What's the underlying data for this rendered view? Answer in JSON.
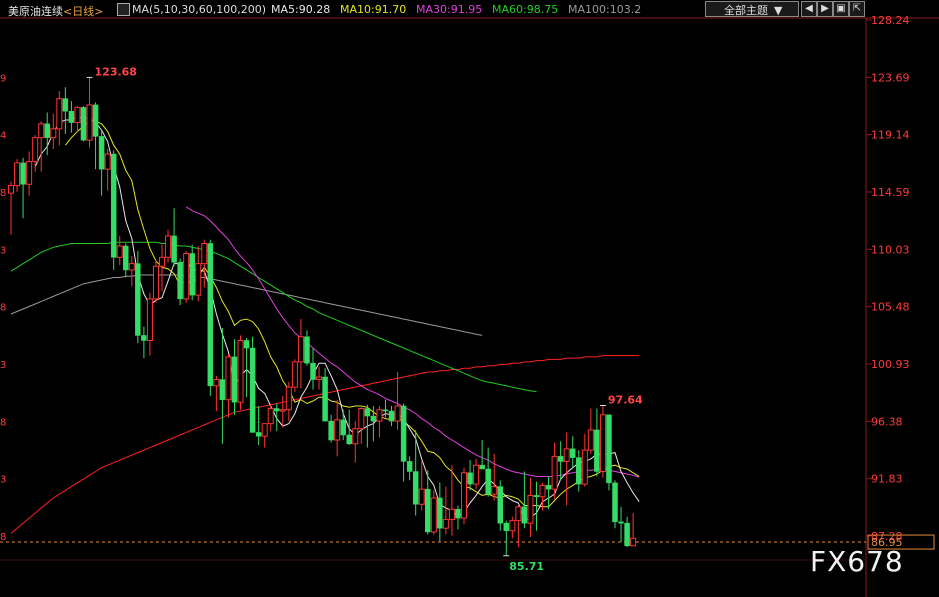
{
  "header": {
    "title": "美原油连续",
    "period": "<日线>",
    "ma_label": "MA(5,10,30,60,100,200)",
    "ma5": "MA5:90.28",
    "ma10": "MA10:91.70",
    "ma30": "MA30:91.95",
    "ma60": "MA60:98.75",
    "ma100": "MA100:103.2",
    "selector": "全部主题",
    "selector_arrow": "▼"
  },
  "watermark": "FX678",
  "colors": {
    "up": "#ff3333",
    "down": "#33dd66",
    "ma5": "#e8e8e8",
    "ma10": "#e6e61e",
    "ma30": "#e040e0",
    "ma60": "#22cc22",
    "ma100": "#9a9a9a",
    "ma200": "#ff2020",
    "axis_text": "#ff3b3b",
    "annotation_high": "#ff4444",
    "annotation_low": "#33dd66"
  },
  "chart_data": {
    "type": "candlestick",
    "ylim": [
      84.0,
      129.2
    ],
    "yticks": [
      128.24,
      123.69,
      119.14,
      114.59,
      110.03,
      105.48,
      100.93,
      96.38,
      91.83,
      87.28
    ],
    "ytick_labels": [
      "128.24",
      "123.69",
      "119.14",
      "114.59",
      "110.03",
      "105.48",
      "100.93",
      "96.38",
      "91.83",
      "87.28"
    ],
    "left_labels": [
      "9",
      "4",
      "8",
      "3",
      "8",
      "3",
      "8",
      "3",
      "8"
    ],
    "current_price": 86.8,
    "current_price_label": "86.95",
    "annotations": [
      {
        "label": "123.68",
        "index": 13,
        "value": 123.68,
        "kind": "high"
      },
      {
        "label": "97.64",
        "index": 98,
        "value": 97.64,
        "kind": "high"
      },
      {
        "label": "85.71",
        "index": 82,
        "value": 85.71,
        "kind": "low"
      }
    ],
    "ohlc": [
      [
        114.5,
        115.4,
        111.2,
        115.1
      ],
      [
        115.1,
        117.2,
        114.6,
        116.9
      ],
      [
        116.9,
        117.3,
        112.5,
        115.2
      ],
      [
        115.2,
        117.8,
        114.3,
        117.0
      ],
      [
        117.0,
        119.1,
        116.2,
        118.9
      ],
      [
        118.9,
        120.2,
        116.2,
        120.0
      ],
      [
        120.0,
        120.9,
        117.5,
        118.9
      ],
      [
        118.9,
        120.8,
        118.0,
        119.6
      ],
      [
        119.6,
        122.6,
        118.3,
        122.0
      ],
      [
        122.0,
        122.9,
        119.2,
        121.0
      ],
      [
        121.0,
        121.8,
        119.3,
        120.1
      ],
      [
        120.1,
        121.4,
        119.3,
        121.3
      ],
      [
        121.3,
        121.4,
        118.6,
        118.7
      ],
      [
        118.7,
        123.68,
        118.1,
        121.5
      ],
      [
        121.5,
        121.7,
        116.4,
        119.0
      ],
      [
        119.0,
        119.5,
        114.3,
        116.4
      ],
      [
        116.4,
        118.0,
        114.7,
        117.6
      ],
      [
        117.6,
        117.9,
        108.4,
        109.4
      ],
      [
        109.4,
        111.1,
        108.8,
        110.3
      ],
      [
        110.3,
        110.5,
        107.8,
        108.4
      ],
      [
        108.4,
        109.5,
        107.1,
        108.9
      ],
      [
        108.9,
        109.9,
        102.6,
        103.2
      ],
      [
        103.2,
        103.9,
        101.4,
        102.8
      ],
      [
        102.8,
        106.6,
        101.6,
        106.1
      ],
      [
        106.1,
        109.2,
        105.8,
        108.7
      ],
      [
        108.7,
        110.4,
        106.7,
        109.4
      ],
      [
        109.4,
        111.6,
        109.0,
        111.1
      ],
      [
        111.1,
        113.3,
        108.7,
        109.0
      ],
      [
        109.0,
        109.3,
        105.6,
        106.1
      ],
      [
        106.1,
        109.9,
        105.8,
        109.7
      ],
      [
        109.7,
        110.4,
        106.0,
        106.4
      ],
      [
        106.4,
        110.3,
        105.9,
        108.9
      ],
      [
        108.9,
        110.8,
        107.0,
        110.5
      ],
      [
        110.5,
        110.8,
        98.4,
        99.2
      ],
      [
        99.2,
        100.0,
        97.2,
        99.7
      ],
      [
        99.7,
        103.8,
        94.6,
        98.1
      ],
      [
        98.1,
        101.7,
        96.7,
        101.5
      ],
      [
        101.5,
        102.9,
        96.9,
        97.9
      ],
      [
        97.9,
        103.2,
        97.3,
        102.8
      ],
      [
        102.8,
        103.0,
        98.3,
        102.2
      ],
      [
        102.2,
        103.1,
        95.5,
        95.5
      ],
      [
        95.5,
        97.6,
        94.5,
        95.2
      ],
      [
        95.2,
        96.2,
        94.3,
        96.2
      ],
      [
        96.2,
        97.8,
        95.6,
        97.4
      ],
      [
        97.4,
        97.8,
        95.6,
        97.2
      ],
      [
        97.2,
        98.4,
        95.9,
        97.3
      ],
      [
        97.3,
        99.5,
        96.4,
        99.1
      ],
      [
        99.1,
        101.3,
        98.7,
        101.1
      ],
      [
        101.1,
        104.5,
        99.0,
        103.1
      ],
      [
        103.1,
        103.6,
        100.8,
        101.0
      ],
      [
        101.0,
        102.2,
        98.9,
        99.7
      ],
      [
        99.7,
        100.7,
        98.9,
        99.9
      ],
      [
        99.9,
        100.6,
        98.8,
        96.4
      ],
      [
        96.4,
        96.9,
        94.7,
        94.9
      ],
      [
        94.9,
        98.1,
        93.6,
        96.5
      ],
      [
        96.5,
        97.3,
        94.9,
        95.3
      ],
      [
        95.3,
        97.3,
        94.5,
        94.6
      ],
      [
        94.6,
        96.4,
        93.1,
        95.8
      ],
      [
        95.8,
        97.5,
        94.6,
        97.4
      ],
      [
        97.4,
        97.7,
        94.3,
        96.8
      ],
      [
        96.8,
        97.6,
        94.8,
        96.4
      ],
      [
        96.4,
        97.6,
        95.1,
        97.3
      ],
      [
        97.3,
        98.1,
        96.7,
        97.2
      ],
      [
        97.2,
        97.6,
        96.0,
        96.4
      ],
      [
        96.4,
        100.3,
        95.7,
        97.6
      ],
      [
        97.6,
        97.8,
        91.6,
        93.2
      ],
      [
        93.2,
        93.6,
        91.7,
        92.4
      ],
      [
        92.4,
        95.7,
        88.9,
        89.8
      ],
      [
        89.8,
        93.2,
        89.3,
        91.0
      ],
      [
        91.0,
        92.5,
        87.4,
        87.6
      ],
      [
        87.6,
        90.9,
        87.4,
        90.3
      ],
      [
        90.3,
        91.5,
        86.8,
        87.9
      ],
      [
        87.9,
        91.2,
        87.4,
        88.6
      ],
      [
        88.6,
        92.9,
        87.3,
        89.4
      ],
      [
        89.4,
        89.7,
        87.8,
        88.7
      ],
      [
        88.7,
        92.7,
        88.2,
        92.3
      ],
      [
        92.3,
        93.3,
        90.9,
        91.4
      ],
      [
        91.4,
        93.4,
        91.0,
        92.9
      ],
      [
        92.9,
        94.9,
        92.7,
        92.6
      ],
      [
        92.6,
        94.3,
        90.4,
        90.6
      ],
      [
        90.6,
        93.8,
        90.1,
        91.2
      ],
      [
        91.2,
        91.7,
        87.7,
        88.3
      ],
      [
        88.3,
        88.5,
        85.71,
        87.7
      ],
      [
        87.7,
        88.8,
        87.1,
        88.5
      ],
      [
        88.5,
        89.7,
        86.4,
        89.6
      ],
      [
        89.6,
        92.4,
        87.9,
        88.3
      ],
      [
        88.3,
        91.9,
        87.2,
        90.5
      ],
      [
        90.5,
        91.6,
        87.7,
        90.4
      ],
      [
        90.4,
        91.5,
        89.3,
        91.3
      ],
      [
        91.3,
        92.0,
        89.4,
        91.0
      ],
      [
        91.0,
        94.7,
        90.2,
        93.6
      ],
      [
        93.6,
        94.8,
        91.7,
        93.2
      ],
      [
        93.2,
        95.5,
        89.7,
        94.2
      ],
      [
        94.2,
        95.2,
        92.7,
        93.5
      ],
      [
        93.5,
        94.1,
        90.8,
        91.4
      ],
      [
        91.4,
        95.4,
        91.2,
        94.1
      ],
      [
        94.1,
        97.4,
        93.8,
        95.7
      ],
      [
        95.7,
        97.4,
        92.0,
        92.4
      ],
      [
        92.4,
        97.64,
        91.9,
        96.9
      ],
      [
        96.9,
        96.9,
        90.9,
        91.5
      ],
      [
        91.5,
        91.7,
        87.9,
        88.4
      ],
      [
        88.4,
        89.6,
        86.8,
        88.3
      ],
      [
        88.3,
        88.8,
        86.4,
        86.5
      ],
      [
        86.5,
        89.1,
        86.5,
        87.1
      ]
    ],
    "ma_lines": {
      "ma5": [
        null,
        null,
        null,
        null,
        116.6,
        117.6,
        118.2,
        119.3,
        120.1,
        120.3,
        120.3,
        120.6,
        120.4,
        120.5,
        120.1,
        119.5,
        118.6,
        116.6,
        115.0,
        112.3,
        110.9,
        108.0,
        106.5,
        105.6,
        106.0,
        106.2,
        107.5,
        108.9,
        108.9,
        109.1,
        108.4,
        108.4,
        108.3,
        106.9,
        104.9,
        103.3,
        101.9,
        99.3,
        100.0,
        100.5,
        100.0,
        99.0,
        98.6,
        97.6,
        96.6,
        96.0,
        96.2,
        97.0,
        98.3,
        99.1,
        100.1,
        101.0,
        101.0,
        100.0,
        98.9,
        97.0,
        95.8,
        95.3,
        95.7,
        96.0,
        96.2,
        96.7,
        97.0,
        96.9,
        97.0,
        96.6,
        95.8,
        95.0,
        93.4,
        92.0,
        91.3,
        89.8,
        89.5,
        89.3,
        88.8,
        89.2,
        89.9,
        90.5,
        91.2,
        91.8,
        91.4,
        90.9,
        90.4,
        90.1,
        89.9,
        88.5,
        88.8,
        89.1,
        90.0,
        90.3,
        90.6,
        91.8,
        92.3,
        92.7,
        93.1,
        93.2,
        93.4,
        93.8,
        93.7,
        93.8,
        93.9,
        92.4,
        91.5,
        90.7,
        90.0
      ],
      "ma10": [
        null,
        null,
        null,
        null,
        null,
        null,
        null,
        null,
        null,
        118.3,
        118.9,
        119.4,
        119.8,
        120.3,
        120.2,
        120.0,
        119.4,
        118.3,
        117.6,
        116.3,
        115.5,
        113.2,
        111.6,
        110.1,
        109.1,
        108.6,
        108.5,
        108.1,
        107.2,
        107.6,
        107.3,
        107.9,
        108.6,
        107.9,
        107.0,
        105.9,
        105.1,
        104.0,
        104.4,
        104.5,
        104.3,
        103.7,
        102.7,
        101.5,
        100.7,
        99.6,
        98.9,
        97.9,
        98.1,
        97.8,
        98.0,
        98.3,
        98.3,
        98.0,
        97.9,
        97.6,
        97.5,
        97.6,
        97.6,
        97.5,
        97.1,
        96.8,
        96.6,
        96.5,
        96.8,
        96.3,
        96.0,
        95.5,
        94.8,
        94.0,
        93.9,
        93.5,
        92.8,
        92.4,
        91.7,
        91.2,
        91.1,
        90.8,
        90.5,
        90.6,
        90.4,
        90.3,
        90.5,
        90.4,
        90.2,
        89.7,
        89.7,
        89.7,
        89.6,
        89.6,
        90.1,
        90.6,
        91.0,
        91.3,
        91.6,
        91.9,
        92.0,
        92.2,
        92.5,
        92.8,
        92.9,
        92.7,
        92.6,
        92.3,
        92.0
      ],
      "ma30": [
        null,
        null,
        null,
        null,
        null,
        null,
        null,
        null,
        null,
        null,
        null,
        null,
        null,
        null,
        null,
        null,
        null,
        null,
        null,
        null,
        null,
        null,
        null,
        null,
        null,
        null,
        null,
        null,
        null,
        113.4,
        113.1,
        112.9,
        112.7,
        112.3,
        111.8,
        111.3,
        110.8,
        110.1,
        109.5,
        109.0,
        108.4,
        107.7,
        106.9,
        106.1,
        105.3,
        104.6,
        104.0,
        103.4,
        103.0,
        102.6,
        102.2,
        101.8,
        101.4,
        101.0,
        100.7,
        100.3,
        99.9,
        99.5,
        99.2,
        98.9,
        98.7,
        98.5,
        98.2,
        98.0,
        97.8,
        97.5,
        97.3,
        97.0,
        96.6,
        96.3,
        95.9,
        95.6,
        95.2,
        94.9,
        94.6,
        94.3,
        94.0,
        93.7,
        93.5,
        93.3,
        93.0,
        92.8,
        92.6,
        92.4,
        92.3,
        92.2,
        92.1,
        92.0,
        92.0,
        92.0,
        92.0,
        92.1,
        92.2,
        92.3,
        92.4,
        92.5,
        92.5,
        92.6,
        92.6,
        92.5,
        92.4,
        92.3,
        92.2,
        92.1,
        91.95
      ],
      "ma60": [
        108.3,
        108.6,
        108.9,
        109.2,
        109.5,
        109.8,
        110.0,
        110.2,
        110.3,
        110.4,
        110.5,
        110.5,
        110.5,
        110.5,
        110.5,
        110.5,
        110.5,
        110.6,
        110.6,
        110.6,
        110.6,
        110.6,
        110.6,
        110.6,
        110.6,
        110.5,
        110.5,
        110.4,
        110.3,
        110.3,
        110.2,
        110.1,
        110.0,
        109.9,
        109.7,
        109.5,
        109.3,
        109.0,
        108.7,
        108.4,
        108.1,
        107.8,
        107.5,
        107.2,
        106.9,
        106.6,
        106.3,
        106.0,
        105.8,
        105.5,
        105.3,
        105.0,
        104.8,
        104.6,
        104.4,
        104.2,
        104.0,
        103.8,
        103.6,
        103.4,
        103.2,
        103.0,
        102.8,
        102.6,
        102.4,
        102.2,
        102.0,
        101.8,
        101.6,
        101.4,
        101.2,
        101.0,
        100.8,
        100.6,
        100.4,
        100.2,
        100.0,
        99.8,
        99.6,
        99.5,
        99.4,
        99.3,
        99.2,
        99.1,
        99.0,
        98.9,
        98.8,
        98.75,
        null,
        null,
        null,
        null,
        null,
        null,
        null,
        null,
        null,
        null,
        null,
        null,
        null,
        null,
        null,
        null,
        null
      ],
      "ma100": [
        104.9,
        105.1,
        105.3,
        105.5,
        105.7,
        105.9,
        106.1,
        106.3,
        106.5,
        106.7,
        106.9,
        107.1,
        107.3,
        107.4,
        107.5,
        107.6,
        107.7,
        107.8,
        107.8,
        107.9,
        107.9,
        108.0,
        108.0,
        108.0,
        108.0,
        108.0,
        108.0,
        108.0,
        108.0,
        107.9,
        107.9,
        107.8,
        107.8,
        107.7,
        107.6,
        107.5,
        107.4,
        107.3,
        107.2,
        107.1,
        107.0,
        106.9,
        106.8,
        106.7,
        106.6,
        106.5,
        106.4,
        106.3,
        106.2,
        106.1,
        106.0,
        105.9,
        105.8,
        105.7,
        105.6,
        105.5,
        105.4,
        105.3,
        105.2,
        105.1,
        105.0,
        104.9,
        104.8,
        104.7,
        104.6,
        104.5,
        104.4,
        104.3,
        104.2,
        104.1,
        104.0,
        103.9,
        103.8,
        103.7,
        103.6,
        103.5,
        103.4,
        103.3,
        103.2,
        null,
        null,
        null,
        null,
        null,
        null,
        null,
        null,
        null,
        null,
        null,
        null,
        null,
        null,
        null,
        null,
        null,
        null,
        null,
        null,
        null,
        null,
        null,
        null,
        null,
        null,
        null
      ],
      "ma200": [
        87.5,
        87.9,
        88.3,
        88.7,
        89.1,
        89.5,
        89.9,
        90.3,
        90.6,
        90.9,
        91.2,
        91.5,
        91.8,
        92.1,
        92.4,
        92.7,
        92.9,
        93.1,
        93.3,
        93.5,
        93.7,
        93.9,
        94.1,
        94.3,
        94.5,
        94.7,
        94.9,
        95.1,
        95.3,
        95.5,
        95.7,
        95.9,
        96.1,
        96.3,
        96.5,
        96.7,
        96.9,
        97.1,
        97.2,
        97.3,
        97.4,
        97.5,
        97.6,
        97.7,
        97.8,
        97.9,
        98.0,
        98.1,
        98.2,
        98.3,
        98.4,
        98.5,
        98.6,
        98.7,
        98.8,
        98.9,
        99.0,
        99.1,
        99.2,
        99.3,
        99.4,
        99.5,
        99.6,
        99.7,
        99.8,
        99.9,
        100.0,
        100.1,
        100.2,
        100.3,
        100.3,
        100.4,
        100.4,
        100.5,
        100.5,
        100.6,
        100.6,
        100.7,
        100.7,
        100.8,
        100.8,
        100.9,
        100.9,
        101.0,
        101.0,
        101.1,
        101.1,
        101.2,
        101.2,
        101.3,
        101.3,
        101.3,
        101.4,
        101.4,
        101.4,
        101.5,
        101.5,
        101.5,
        101.6,
        101.6,
        101.6,
        101.6,
        101.6,
        101.6,
        101.6
      ]
    }
  }
}
